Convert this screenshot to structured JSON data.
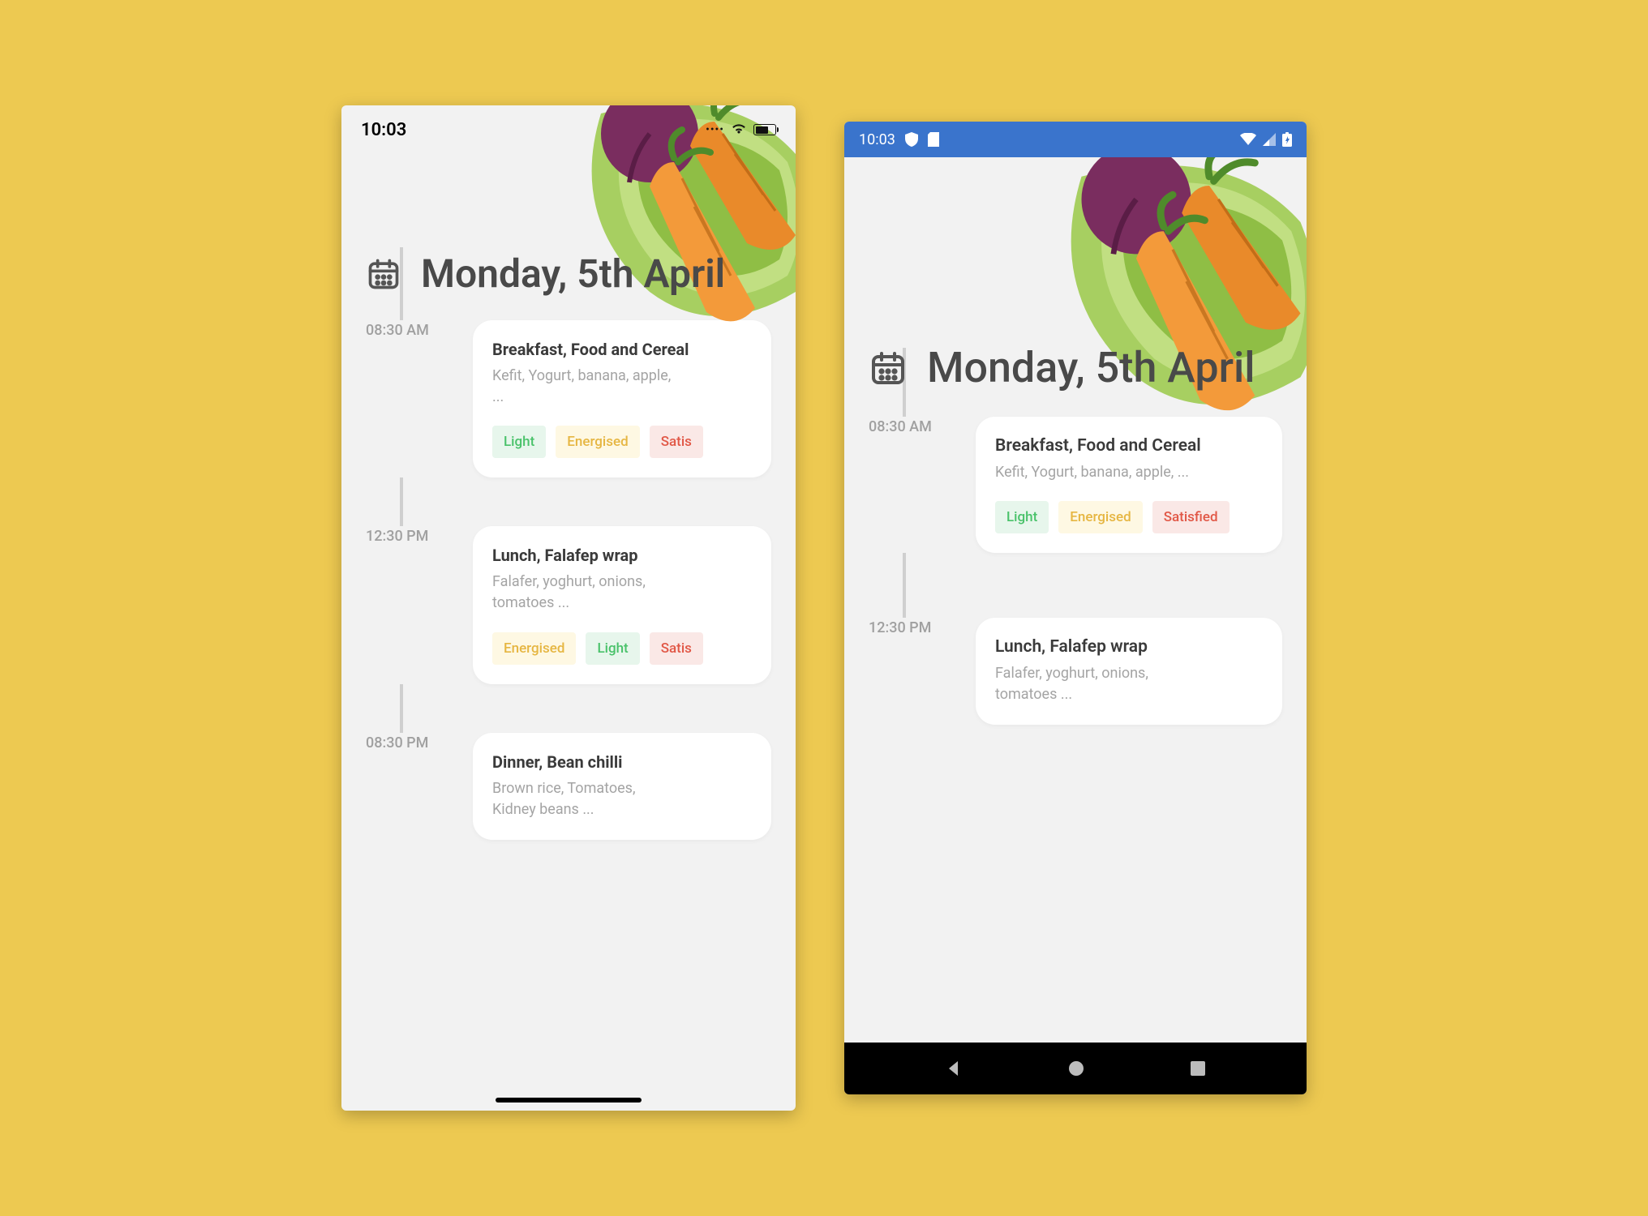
{
  "status_time": "10:03",
  "date_title": "Monday, 5th April",
  "entries": [
    {
      "time": "08:30 AM",
      "title": "Breakfast, Food and Cereal",
      "desc_ios": "Kefit, Yogurt, banana, apple, ...",
      "desc_android": "Kefit, Yogurt, banana, apple, ...",
      "tags": [
        {
          "label": "Light",
          "kind": "light"
        },
        {
          "label": "Energised",
          "kind": "energised"
        },
        {
          "label": "Satisfied",
          "kind": "satisfied"
        }
      ],
      "tags_ios_truncated_last": "Satis"
    },
    {
      "time": "12:30 PM",
      "title": "Lunch, Falafep wrap",
      "desc_ios": "Falafer, yoghurt, onions, tomatoes ...",
      "desc_android": "Falafer, yoghurt, onions, tomatoes ...",
      "tags": [
        {
          "label": "Energised",
          "kind": "energised"
        },
        {
          "label": "Light",
          "kind": "light"
        },
        {
          "label": "Satisfied",
          "kind": "satisfied"
        }
      ],
      "tags_ios_truncated_last": "Satis"
    },
    {
      "time": "08:30 PM",
      "title": "Dinner, Bean chilli",
      "desc_ios": "Brown rice, Tomatoes, Kidney beans ...",
      "tags": []
    }
  ]
}
